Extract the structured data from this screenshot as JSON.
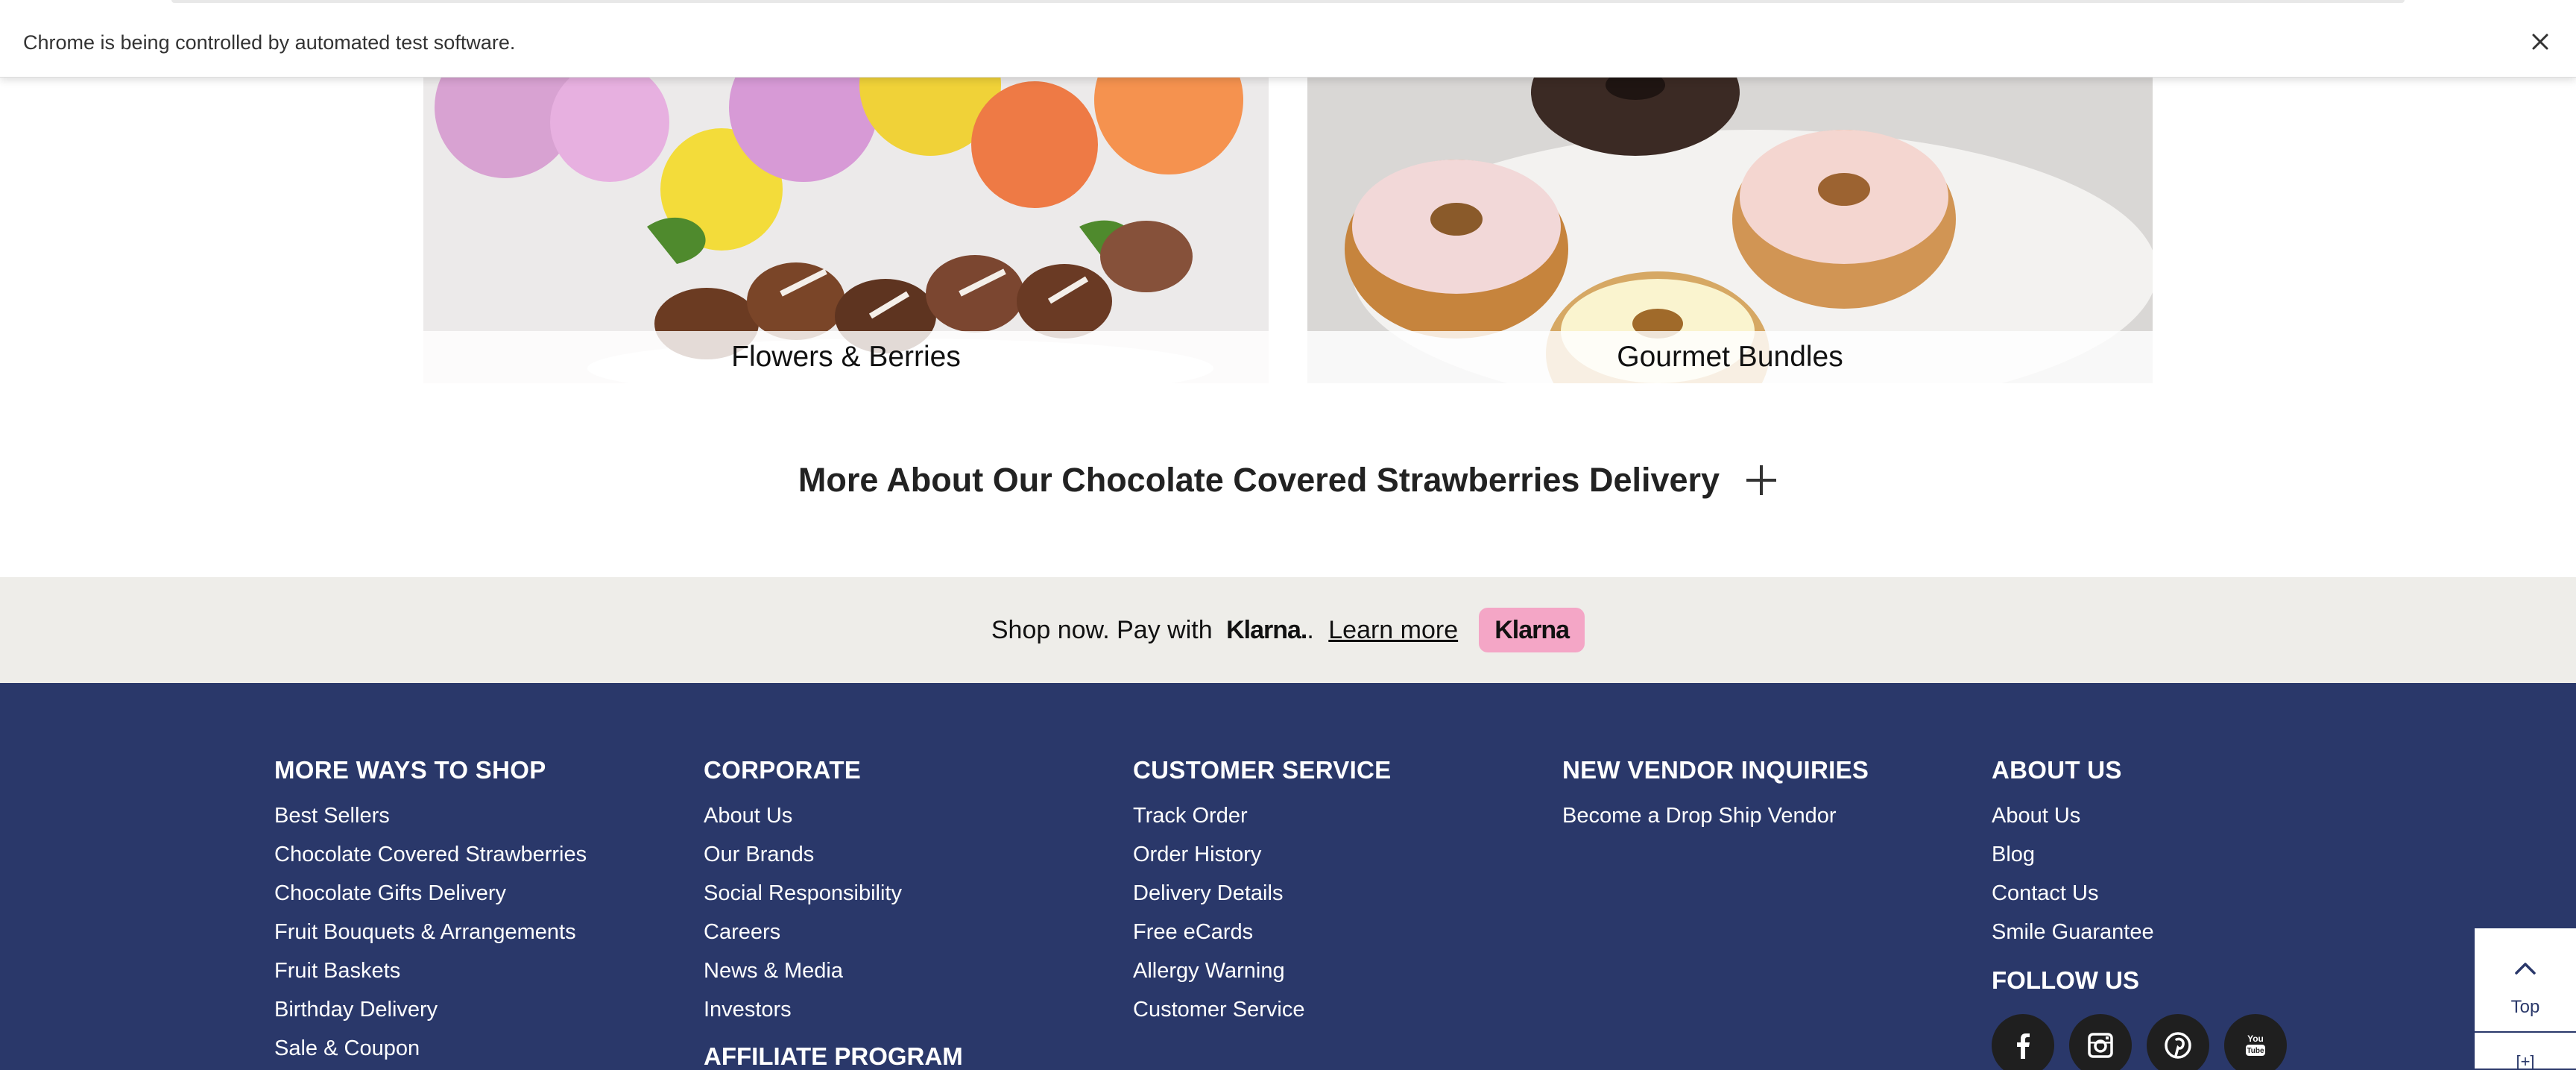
{
  "browser": {
    "infobar_text": "Chrome is being controlled by automated test software."
  },
  "tiles": [
    {
      "caption": "Flowers & Berries"
    },
    {
      "caption": "Gourmet Bundles"
    }
  ],
  "more_about": {
    "title": "More About Our Chocolate Covered Strawberries Delivery"
  },
  "klarna": {
    "prefix": "Shop now. Pay with",
    "brand": "Klarna.",
    "suffix": ".",
    "link": "Learn more",
    "badge": "Klarna",
    "badge_color": "#f4a6c6"
  },
  "footer": {
    "bg_color": "#2a386a",
    "columns": [
      {
        "heading": "MORE WAYS TO SHOP",
        "links": [
          "Best Sellers",
          "Chocolate Covered Strawberries",
          "Chocolate Gifts Delivery",
          "Fruit Bouquets & Arrangements",
          "Fruit Baskets",
          "Birthday Delivery",
          "Sale & Coupon"
        ]
      },
      {
        "heading": "CORPORATE",
        "links": [
          "About Us",
          "Our Brands",
          "Social Responsibility",
          "Careers",
          "News & Media",
          "Investors"
        ],
        "sub_heading": "AFFILIATE PROGRAM"
      },
      {
        "heading": "CUSTOMER SERVICE",
        "links": [
          "Track Order",
          "Order History",
          "Delivery Details",
          "Free eCards",
          "Allergy Warning",
          "Customer Service"
        ]
      },
      {
        "heading": "NEW VENDOR INQUIRIES",
        "links": [
          "Become a Drop Ship Vendor"
        ]
      },
      {
        "heading": "ABOUT US",
        "links": [
          "About Us",
          "Blog",
          "Contact Us",
          "Smile Guarantee"
        ],
        "follow_heading": "FOLLOW US",
        "social": [
          "facebook-icon",
          "instagram-icon",
          "pinterest-icon",
          "youtube-icon"
        ]
      }
    ]
  },
  "top_widget": {
    "label": "Top",
    "secondary": "[+]"
  }
}
